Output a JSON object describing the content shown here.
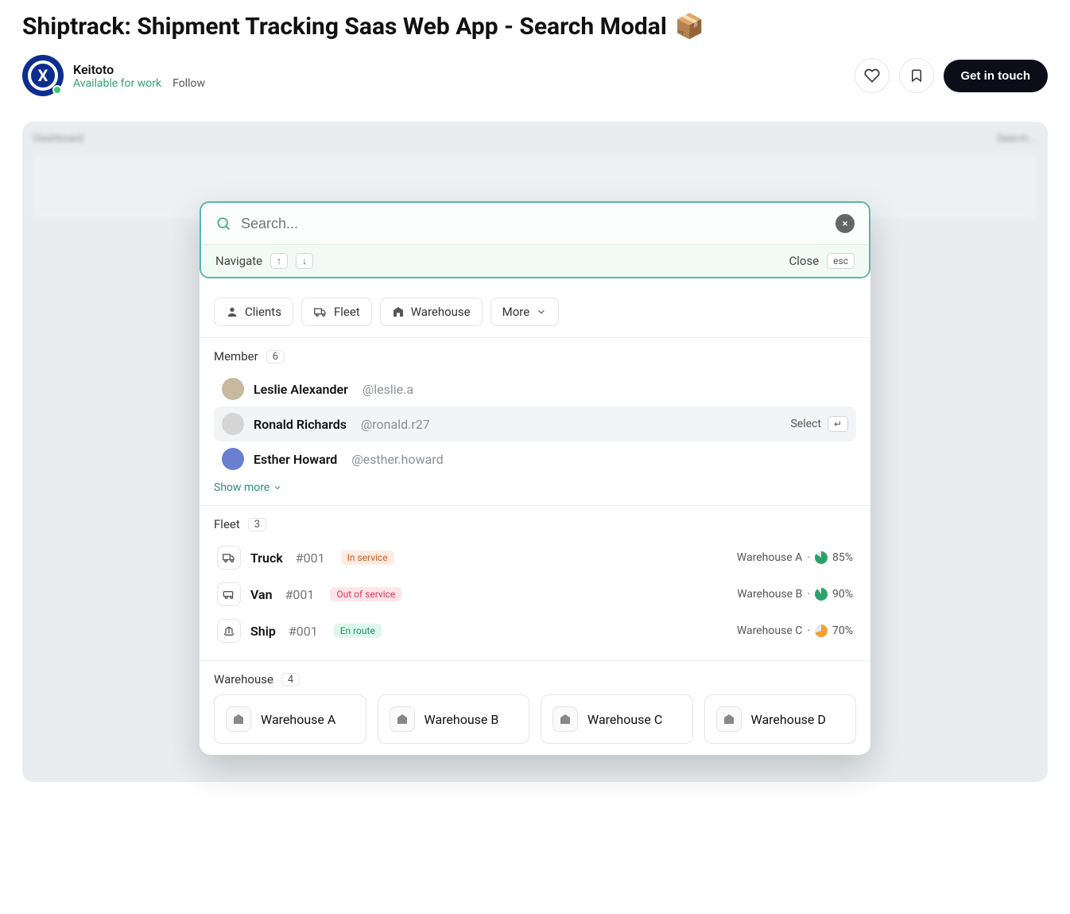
{
  "page": {
    "title": "Shiptrack: Shipment Tracking Saas Web App - Search Modal",
    "emoji": "📦"
  },
  "author": {
    "name": "Keitoto",
    "availability": "Available for work",
    "follow_label": "Follow",
    "cta_label": "Get in touch"
  },
  "dashboard_bg": {
    "heading": "Dashboard",
    "search_placeholder": "Search..."
  },
  "modal": {
    "search_placeholder": "Search...",
    "navigate_label": "Navigate",
    "close_label": "Close",
    "esc_key": "esc",
    "filters": {
      "clients": "Clients",
      "fleet": "Fleet",
      "warehouse": "Warehouse",
      "more": "More"
    },
    "member_section": {
      "label": "Member",
      "count": "6",
      "show_more": "Show more",
      "items": [
        {
          "name": "Leslie Alexander",
          "handle": "@leslie.a"
        },
        {
          "name": "Ronald Richards",
          "handle": "@ronald.r27",
          "selected": true
        },
        {
          "name": "Esther Howard",
          "handle": "@esther.howard"
        }
      ],
      "select_label": "Select"
    },
    "fleet_section": {
      "label": "Fleet",
      "count": "3",
      "items": [
        {
          "type": "Truck",
          "id": "#001",
          "status": "In service",
          "warehouse": "Warehouse A",
          "percent": "85%"
        },
        {
          "type": "Van",
          "id": "#001",
          "status": "Out of service",
          "warehouse": "Warehouse B",
          "percent": "90%"
        },
        {
          "type": "Ship",
          "id": "#001",
          "status": "En route",
          "warehouse": "Warehouse C",
          "percent": "70%"
        }
      ]
    },
    "warehouse_section": {
      "label": "Warehouse",
      "count": "4",
      "items": [
        "Warehouse A",
        "Warehouse B",
        "Warehouse C",
        "Warehouse D"
      ]
    }
  }
}
